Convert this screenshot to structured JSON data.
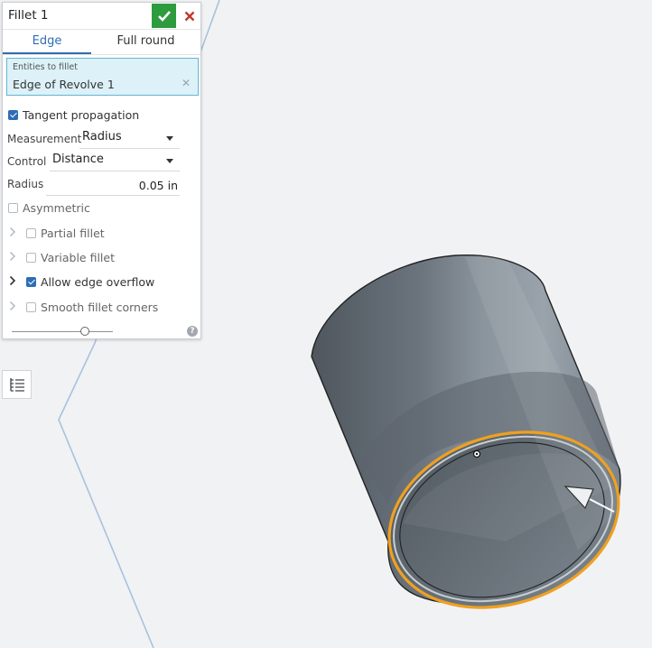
{
  "panel": {
    "title": "Fillet 1",
    "tabs": [
      {
        "label": "Edge",
        "active": true
      },
      {
        "label": "Full round",
        "active": false
      }
    ],
    "entities": {
      "label": "Entities to fillet",
      "value": "Edge of Revolve 1"
    },
    "tangent_propagation": {
      "label": "Tangent propagation",
      "checked": true
    },
    "measurement": {
      "label": "Measurement",
      "value": "Radius"
    },
    "control": {
      "label": "Control",
      "value": "Distance"
    },
    "radius": {
      "label": "Radius",
      "value": "0.05 in"
    },
    "asymmetric": {
      "label": "Asymmetric",
      "checked": false
    },
    "options": [
      {
        "label": "Partial fillet",
        "checked": false
      },
      {
        "label": "Variable fillet",
        "checked": false
      },
      {
        "label": "Allow edge overflow",
        "checked": true
      },
      {
        "label": "Smooth fillet corners",
        "checked": false
      }
    ],
    "slider_position": 0.72,
    "help_glyph": "?"
  },
  "colors": {
    "accent": "#2e6db4",
    "confirm": "#2d9b3e",
    "cancel": "#c0392b",
    "selection": "#f0a020",
    "part": "#707a83"
  },
  "icons": [
    "checkmark-icon",
    "close-icon",
    "clear-icon",
    "chevron-right-icon",
    "help-icon",
    "feature-list-icon",
    "arrow-manipulator-icon"
  ]
}
